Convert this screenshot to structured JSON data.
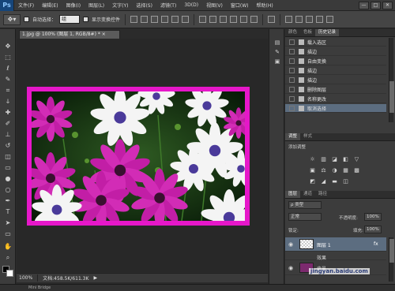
{
  "app": {
    "logo": "Ps"
  },
  "menu": [
    "文件(F)",
    "编辑(E)",
    "图像(I)",
    "图层(L)",
    "文字(Y)",
    "选择(S)",
    "滤镜(T)",
    "3D(D)",
    "视图(V)",
    "窗口(W)",
    "帮助(H)"
  ],
  "window_controls": [
    "—",
    "□",
    "✕"
  ],
  "options": {
    "auto_select_label": "自动选择：",
    "auto_select_value": "组",
    "show_transform_label": "显示变换控件"
  },
  "document": {
    "tab_title": "1.jpg @ 100% (图层 1, RGB/8#) *",
    "tab_close": "×"
  },
  "status": {
    "zoom": "100%",
    "doc_size": "文档:458.5K/611.3K"
  },
  "bottom": {
    "label": "Mini Bridge"
  },
  "history_panel": {
    "tabs": [
      "颜色",
      "色板",
      "历史记录"
    ],
    "active_tab": "历史记录",
    "items": [
      "载入选区",
      "描边",
      "自由变换",
      "描边",
      "描边",
      "删除图层",
      "名称更改",
      "取消选择"
    ],
    "selected_index": 7
  },
  "adjustments_panel": {
    "tabs": [
      "调整",
      "样式"
    ],
    "add_adjustment_label": "添加调整",
    "row1_icons": [
      "☼",
      "▥",
      "◪",
      "◧",
      "▽"
    ],
    "row2_icons": [
      "▣",
      "⚖",
      "◑",
      "▦",
      "▩"
    ],
    "row3_icons": [
      "◩",
      "◢",
      "▬",
      "◫"
    ]
  },
  "layers_panel": {
    "tabs": [
      "图层",
      "通道",
      "路径"
    ],
    "kind_label": "ρ 类型",
    "blend_mode": "正常",
    "opacity_label": "不透明度:",
    "opacity_value": "100%",
    "lock_label": "锁定:",
    "fill_label": "填充:",
    "fill_value": "100%",
    "layers": [
      {
        "name": "图层 1",
        "fx": "fx"
      },
      {
        "name": "效果"
      },
      {
        "name": "背景"
      }
    ]
  },
  "watermark": {
    "text": "jingyan.baidu.com"
  },
  "colors": {
    "frame_magenta": "#e617c9",
    "selection_blue": "#5c6d80",
    "panel_bg": "#3c3c3c"
  }
}
